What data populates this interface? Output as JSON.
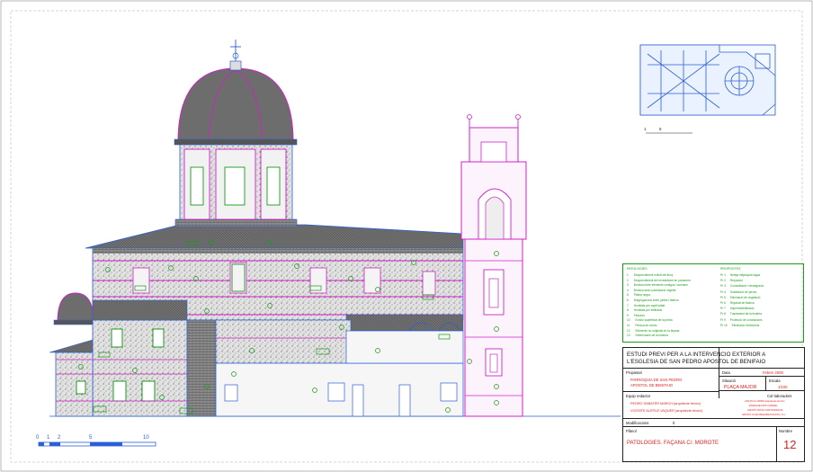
{
  "project_title_line1": "ESTUDI PREVI PER A LA INTERVENCIO EXTERIOR A",
  "project_title_line2": "L'ESGLESIA DE SAN PEDRO APOSTOL DE BENIFAIO",
  "owner_label": "Propietari",
  "owner_line1": "PARROQUIA DE SAN PEDRO",
  "owner_line2": "APOSTOL DE BENIFAIO",
  "date_label": "Data",
  "date_value": "Febrer 2008",
  "location_label": "Situació",
  "location_value": "PLAÇA MAJOR",
  "scale_label": "Escala",
  "scale_value": "1/100",
  "team_label": "Equip redactor",
  "team_member1": "PEDRO SABATER MARCH (arquitecte tècnic)",
  "team_member2": "VICENTE ALEPUZ VAQUER (arquitecte tècnic)",
  "collab_label": "Col·laboradors",
  "collaborators": [
    "ANA PLA LOPEZ (arquitecte tècnic)",
    "ENRIQUE MAS CANDEL",
    "GRUPO NOVA CARTOGRAFIA",
    "GRUPO CLAR REHABILITACION, S.L."
  ],
  "modifications_label": "Modificacions",
  "modifications_value": "0",
  "plan_label": "Plànol",
  "plan_title": "PATOLOGIES. FAÇANA C/. MOROTE",
  "number_label": "Nombre",
  "number_value": "12",
  "legend_left_title": "PATOLOGIES",
  "legend_right_title": "PROPOSTES",
  "legend_left_items": [
    {
      "code": "1",
      "text": "Desprendiment enlluït del llenç"
    },
    {
      "code": "2",
      "text": "Desprendiment del revestiment en parament"
    },
    {
      "code": "3",
      "text": "Brutícia entre elements contigus i cornises"
    },
    {
      "code": "4",
      "text": "Brutícia amb colonització vegetal"
    },
    {
      "code": "5",
      "text": "Pàtina negra"
    },
    {
      "code": "6",
      "text": "Disgregacions entre juntes i fàbrica"
    },
    {
      "code": "7",
      "text": "Humitats per capil·laritat"
    },
    {
      "code": "8",
      "text": "Humitats per infiltració"
    },
    {
      "code": "9",
      "text": "Fissures"
    },
    {
      "code": "10",
      "text": "Erosió superficial de la pedra"
    },
    {
      "code": "11",
      "text": "Pèrdua de volum"
    },
    {
      "code": "12",
      "text": "Elements no originals en la façana"
    },
    {
      "code": "13",
      "text": "Deterioració de la fusteria"
    }
  ],
  "legend_right_items": [
    {
      "code": "Pr 1",
      "text": "Neteja mitjançant aigua"
    },
    {
      "code": "Pr 2",
      "text": "Reposició"
    },
    {
      "code": "Pr 3",
      "text": "Consolidació i reintegració"
    },
    {
      "code": "Pr 4",
      "text": "Substitució de peces"
    },
    {
      "code": "Pr 5",
      "text": "Eliminació de vegetació"
    },
    {
      "code": "Pr 6",
      "text": "Rejuntat de fàbrica"
    },
    {
      "code": "Pr 7",
      "text": "Impermeabilització"
    },
    {
      "code": "Pr 8",
      "text": "Tractament de la fusteria"
    },
    {
      "code": "Pr 9",
      "text": "Protecció de coronacions"
    },
    {
      "code": "Pr 10",
      "text": "Eliminació d'elements"
    }
  ],
  "scale_bar_labels": [
    "0",
    "1",
    "2",
    "5",
    "10"
  ],
  "keyplan_scale_labels": [
    "1",
    "5"
  ],
  "colors": {
    "pathology_green": "#1a9a1a",
    "wall_magenta": "#d020c8",
    "outline_blue": "#2a5fd8",
    "title_red": "#e02020",
    "ink": "#222222"
  }
}
